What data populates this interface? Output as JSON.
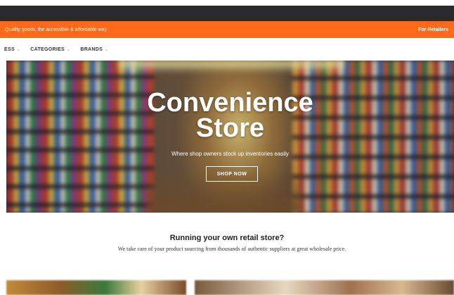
{
  "promo": {
    "tagline": "Quality goods, the accessible & affordable way",
    "retailers_link": "For Retailers"
  },
  "nav": {
    "items": [
      {
        "label": "ESS",
        "chevron": "⌄"
      },
      {
        "label": "CATEGORIES",
        "chevron": "⌄"
      },
      {
        "label": "BRANDS",
        "chevron": "⌄"
      }
    ]
  },
  "hero": {
    "title_line1": "Convenience",
    "title_line2": "Store",
    "subtitle": "Where shop owners stock up inventories easily",
    "cta": "SHOP NOW"
  },
  "section": {
    "title": "Running your own retail store?",
    "text": "We take care of your product sourcing from thousands of authentic suppliers at great wholesale price."
  },
  "colors": {
    "accent": "#ff6a1a",
    "dark": "#2a2a2a"
  }
}
